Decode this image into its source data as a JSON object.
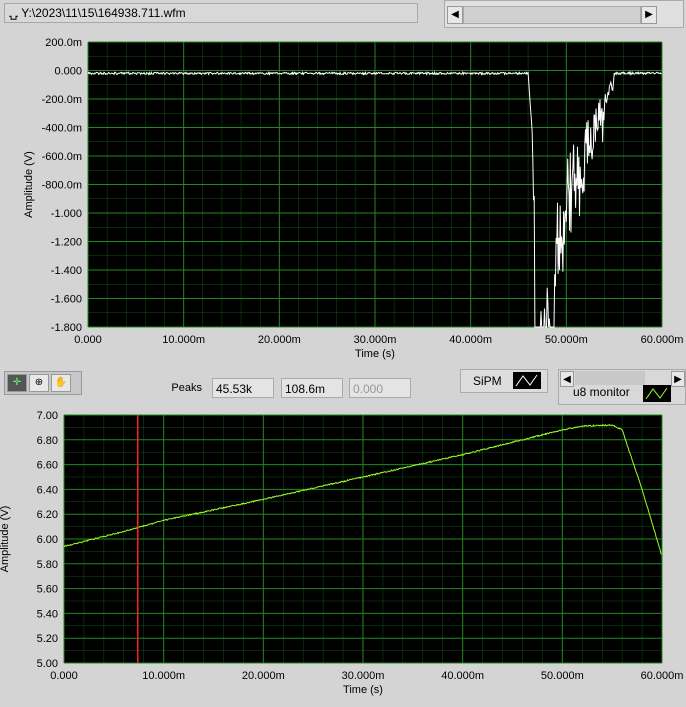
{
  "file_path": "Y:\\2023\\11\\15\\164938.711.wfm",
  "toolbar": {
    "peaks_label": "Peaks",
    "peak1": "45.53k",
    "peak2": "108.6m",
    "peak3": "0.000",
    "legend1": "SiPM",
    "legend2": "u8 monitor"
  },
  "colors": {
    "plot_bg": "#000000",
    "grid": "#1f8a1f",
    "trace_top": "#ffffff",
    "trace_bottom": "#9cff2a",
    "cursor": "#ff2020"
  },
  "chart_data": [
    {
      "type": "line",
      "xlabel": "Time (s)",
      "ylabel": "Amplitude (V)",
      "xlim": [
        0,
        0.06
      ],
      "ylim": [
        -1.8,
        0.2
      ],
      "xticks": [
        "0.000",
        "10.000m",
        "20.000m",
        "30.000m",
        "40.000m",
        "50.000m",
        "60.000m"
      ],
      "yticks": [
        "200.0m",
        "0.000",
        "-200.0m",
        "-400.0m",
        "-600.0m",
        "-800.0m",
        "-1.000",
        "-1.200",
        "-1.400",
        "-1.600",
        "-1.800"
      ],
      "series": [
        {
          "name": "SiPM",
          "points": [
            [
              0,
              -0.02
            ],
            [
              0.046,
              -0.02
            ],
            [
              0.0465,
              -0.5
            ],
            [
              0.047,
              -1.8
            ],
            [
              0.048,
              -1.3
            ],
            [
              0.0485,
              -1.8
            ],
            [
              0.049,
              -0.9
            ],
            [
              0.05,
              -0.6
            ],
            [
              0.052,
              -0.35
            ],
            [
              0.054,
              -0.15
            ],
            [
              0.055,
              -0.02
            ],
            [
              0.06,
              -0.02
            ]
          ]
        }
      ]
    },
    {
      "type": "line",
      "xlabel": "Time (s)",
      "ylabel": "Amplitude (V)",
      "xlim": [
        0,
        0.06
      ],
      "ylim": [
        5.0,
        7.0
      ],
      "xticks": [
        "0.000",
        "10.000m",
        "20.000m",
        "30.000m",
        "40.000m",
        "50.000m",
        "60.000m"
      ],
      "yticks": [
        "7.00",
        "6.80",
        "6.60",
        "6.40",
        "6.20",
        "6.00",
        "5.80",
        "5.60",
        "5.40",
        "5.20",
        "5.00"
      ],
      "cursor_x": 0.0074,
      "series": [
        {
          "name": "u8 monitor",
          "points": [
            [
              0,
              5.94
            ],
            [
              0.005,
              6.04
            ],
            [
              0.01,
              6.15
            ],
            [
              0.02,
              6.32
            ],
            [
              0.03,
              6.5
            ],
            [
              0.04,
              6.68
            ],
            [
              0.05,
              6.88
            ],
            [
              0.052,
              6.91
            ],
            [
              0.055,
              6.92
            ],
            [
              0.056,
              6.88
            ],
            [
              0.058,
              6.4
            ],
            [
              0.06,
              5.86
            ]
          ]
        }
      ]
    }
  ]
}
